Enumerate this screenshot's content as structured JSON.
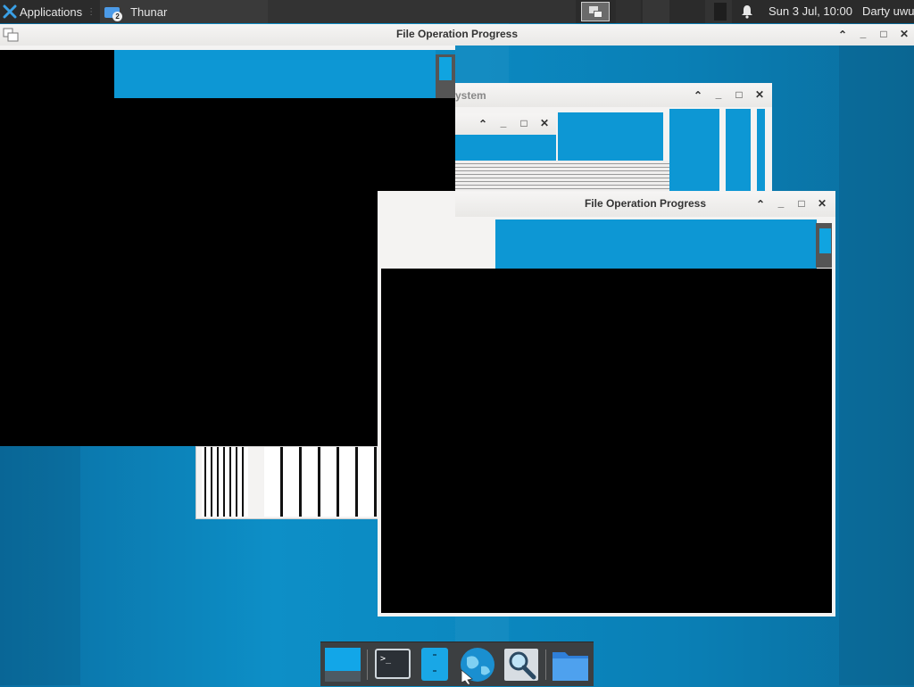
{
  "top_panel": {
    "applications_label": "Applications",
    "task_label": "Thunar",
    "task_badge": "2",
    "clock": "Sun  3 Jul, 10:00",
    "user": "Darty uwu"
  },
  "window_main": {
    "title": "File Operation Progress"
  },
  "window_back": {
    "title_fragment": "ystem"
  },
  "window_front": {
    "title": "File Operation Progress"
  },
  "icons": {
    "applications": "xfce-logo-icon",
    "task": "folder-icon",
    "workspace": "workspace-switcher-icon",
    "notifications": "bell-icon",
    "window_menu": "window-menu-icon",
    "shade": "chevron-up-icon",
    "minimize": "minimize-icon",
    "maximize": "maximize-icon",
    "close": "close-icon"
  },
  "dock": {
    "items": [
      "show-desktop-icon",
      "terminal-icon",
      "file-manager-icon",
      "web-browser-icon",
      "app-finder-icon",
      "folder-icon"
    ]
  },
  "colors": {
    "panel": "#2b2b2b",
    "desktop_blue": "#0d8fc7",
    "titlebar": "#efeeec"
  }
}
